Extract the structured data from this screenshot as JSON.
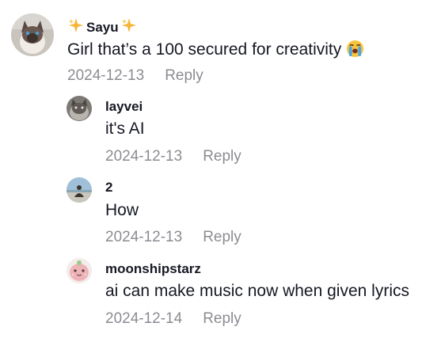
{
  "comments": [
    {
      "username": "Sayu",
      "text": "Girl that’s a 100 secured for creativity",
      "date": "2024-12-13",
      "reply_label": "Reply",
      "avatar_icon": "cat-avatar",
      "username_decoration": "sparkles-icon",
      "text_emoji": "loudly-crying-face-emoji"
    },
    {
      "username": "layvei",
      "text": "it's AI",
      "date": "2024-12-13",
      "reply_label": "Reply",
      "avatar_icon": "cat-avatar"
    },
    {
      "username": "2",
      "text": "How",
      "date": "2024-12-13",
      "reply_label": "Reply",
      "avatar_icon": "person-sky-avatar"
    },
    {
      "username": "moonshipstarz",
      "text": "ai can make music now when given lyrics",
      "date": "2024-12-14",
      "reply_label": "Reply",
      "avatar_icon": "pink-character-avatar"
    }
  ],
  "colors": {
    "text": "#161823",
    "meta": "#8a8b91",
    "sparkle": "#f5b63a"
  }
}
